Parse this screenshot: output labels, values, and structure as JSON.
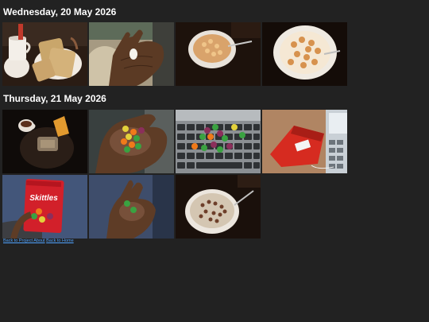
{
  "days": [
    {
      "heading": "Wednesday, 20 May 2026",
      "photos": [
        "photo-mug-and-toast",
        "photo-hand-holding-pill",
        "photo-cereal-bowl",
        "photo-cereal-bowl-closeup"
      ]
    },
    {
      "heading": "Thursday, 21 May 2026",
      "photos": [
        "photo-tea-and-snacks",
        "photo-hand-with-candies",
        "photo-candies-on-keyboard",
        "photo-candy-bag-on-laptop",
        "photo-skittles-bag",
        "photo-hand-with-green-candies",
        "photo-rice-bowl"
      ]
    }
  ],
  "skittles_brand_text": "Skittles",
  "footer": {
    "link_project": "Back to Project About",
    "separator": " ",
    "link_home": "Back to Home"
  },
  "colors": {
    "background": "#222222",
    "text": "#ffffff",
    "link": "#4fa3ff"
  }
}
